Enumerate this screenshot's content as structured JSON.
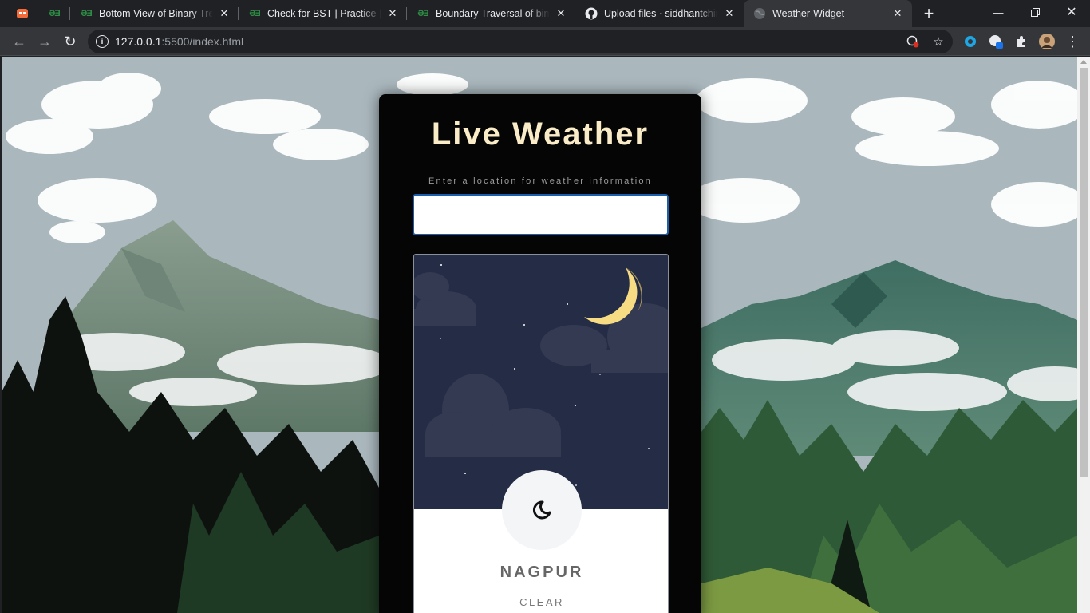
{
  "browser": {
    "tabs": [
      {
        "title": "",
        "favicon": "app-icon",
        "active": false
      },
      {
        "title": "",
        "favicon": "geeksforgeeks-icon",
        "active": false
      },
      {
        "title": "Bottom View of Binary Tree |",
        "favicon": "geeksforgeeks-icon",
        "active": false
      },
      {
        "title": "Check for BST | Practice | Ge",
        "favicon": "geeksforgeeks-icon",
        "active": false
      },
      {
        "title": "Boundary Traversal of binary",
        "favicon": "geeksforgeeks-icon",
        "active": false
      },
      {
        "title": "Upload files · siddhantchima",
        "favicon": "github-icon",
        "active": false
      },
      {
        "title": "Weather-Widget",
        "favicon": "globe-icon",
        "active": true
      }
    ],
    "url_host": "127.0.0.1",
    "url_rest": ":5500/index.html"
  },
  "page": {
    "heading": "Live Weather",
    "input_hint": "Enter a location for weather information",
    "location_value": "",
    "location_placeholder": "",
    "weather": {
      "city": "NAGPUR",
      "condition": "CLEAR",
      "icon": "crescent-moon-icon",
      "scene": "night-sky-moon-clouds"
    }
  },
  "colors": {
    "card_bg": "#050505",
    "heading": "#fbecc8",
    "sky": "#242c46",
    "moon": "#f7dc83",
    "input_border": "#1b5eab"
  }
}
